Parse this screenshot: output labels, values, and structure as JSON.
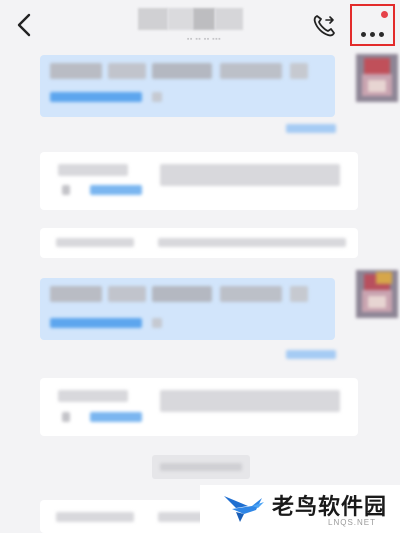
{
  "header": {
    "back_icon": "chevron-left-icon",
    "call_icon": "phone-plus-icon",
    "more_icon": "more-horizontal-icon",
    "more_badge_color": "#e6424a",
    "highlight_color": "#e32b2b"
  },
  "watermark": {
    "name": "老鸟软件园",
    "domain": "LNQS.NET"
  },
  "colors": {
    "outgoing_bubble": "#d2e5fb",
    "incoming_card": "#ffffff",
    "link_blue": "#5da6ee",
    "background": "#f3f3f5"
  }
}
